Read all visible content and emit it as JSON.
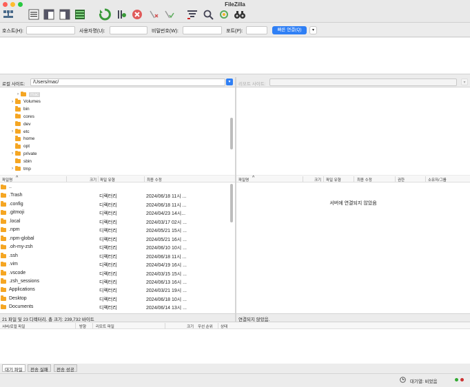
{
  "window": {
    "title": "FileZilla"
  },
  "toolbar": {
    "icons": [
      "site-manager-icon",
      "message-log-icon",
      "local-tree-icon",
      "remote-tree-icon",
      "transfer-queue-icon",
      "refresh-icon",
      "process-queue-icon",
      "cancel-icon",
      "disconnect-icon",
      "reconnect-icon",
      "filter-icon",
      "compare-icon",
      "sync-browse-icon",
      "search-icon"
    ]
  },
  "quickconnect": {
    "host_label": "호스트(H):",
    "user_label": "사용자명(U):",
    "pass_label": "비밀번호(W):",
    "port_label": "포트(P):",
    "button_label": "빠른 연결(Q)",
    "dropdown": "▾"
  },
  "local": {
    "site_label": "로컬 사이트:",
    "path": "/Users/mac/",
    "tree": [
      {
        "label": "mac",
        "expand": true,
        "highlight": true,
        "indent": 1
      },
      {
        "label": "Volumes",
        "expand": true,
        "highlight": false,
        "indent": 0
      },
      {
        "label": "bin",
        "expand": false,
        "highlight": false,
        "indent": 0
      },
      {
        "label": "cores",
        "expand": false,
        "highlight": false,
        "indent": 0
      },
      {
        "label": "dev",
        "expand": false,
        "highlight": false,
        "indent": 0
      },
      {
        "label": "etc",
        "expand": true,
        "highlight": false,
        "indent": 0
      },
      {
        "label": "home",
        "expand": false,
        "highlight": false,
        "indent": 0
      },
      {
        "label": "opt",
        "expand": false,
        "highlight": false,
        "indent": 0
      },
      {
        "label": "private",
        "expand": true,
        "highlight": false,
        "indent": 0
      },
      {
        "label": "sbin",
        "expand": false,
        "highlight": false,
        "indent": 0
      },
      {
        "label": "tmp",
        "expand": true,
        "highlight": false,
        "indent": 0
      }
    ],
    "columns": [
      "파일명",
      "크기",
      "파일 유형",
      "최종 수정"
    ],
    "sort_icon": "^",
    "files": [
      {
        "name": "..",
        "type": "",
        "modified": ""
      },
      {
        "name": ".Trash",
        "type": "디렉터리",
        "modified": "2024/06/18 11시 ..."
      },
      {
        "name": ".config",
        "type": "디렉터리",
        "modified": "2024/06/18 11시 ..."
      },
      {
        "name": ".gitmoji",
        "type": "디렉터리",
        "modified": "2024/04/23 14시..."
      },
      {
        "name": ".local",
        "type": "디렉터리",
        "modified": "2024/03/17 02시 ..."
      },
      {
        "name": ".npm",
        "type": "디렉터리",
        "modified": "2024/05/21 15시 ..."
      },
      {
        "name": ".npm-global",
        "type": "디렉터리",
        "modified": "2024/05/21 16시 ..."
      },
      {
        "name": ".oh-my-zsh",
        "type": "디렉터리",
        "modified": "2024/06/10 10시 ..."
      },
      {
        "name": ".ssh",
        "type": "디렉터리",
        "modified": "2024/06/18 11시 ..."
      },
      {
        "name": ".vim",
        "type": "디렉터리",
        "modified": "2024/04/19 16시 ..."
      },
      {
        "name": ".vscode",
        "type": "디렉터리",
        "modified": "2024/03/15 15시 ..."
      },
      {
        "name": ".zsh_sessions",
        "type": "디렉터리",
        "modified": "2024/06/13 16시 ..."
      },
      {
        "name": "Applications",
        "type": "디렉터리",
        "modified": "2024/03/21 19시 ..."
      },
      {
        "name": "Desktop",
        "type": "디렉터리",
        "modified": "2024/06/18 10시 ..."
      },
      {
        "name": "Documents",
        "type": "디렉터리",
        "modified": "2024/06/14 13시 ..."
      }
    ],
    "status": "21 파일 및 23 디렉터리. 총 크기: 239,732 바이트"
  },
  "remote": {
    "site_label": "리모트 사이트:",
    "path": "",
    "columns": [
      "파일명",
      "크기",
      "파일 유형",
      "최종 수정",
      "권한",
      "소유자/그룹"
    ],
    "sort_icon": "^",
    "empty_message": "서버에 연결되지 않았음",
    "status": "연결되지 않았음."
  },
  "queue": {
    "columns": [
      "서버/로컬 파일",
      "방향",
      "리모트 파일",
      "크기",
      "우선 순위",
      "상태"
    ],
    "tabs": [
      "대기 파일",
      "전송 실패",
      "전송 성공"
    ]
  },
  "bottom": {
    "queue_label": "대기열: 비었음"
  },
  "colors": {
    "accent": "#2f7ff5",
    "folder": "#f5a623"
  }
}
